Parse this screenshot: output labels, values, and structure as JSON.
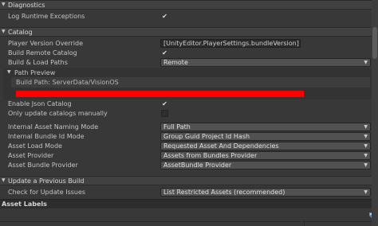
{
  "sections": {
    "diagnostics": "Diagnostics",
    "catalog": "Catalog",
    "update_prev": "Update a Previous Build",
    "asset_labels": "Asset Labels"
  },
  "rows": {
    "log_runtime": "Log Runtime Exceptions",
    "player_version": "Player Version Override",
    "player_version_value": "[UnityEditor.PlayerSettings.bundleVersion]",
    "build_remote": "Build Remote Catalog",
    "build_load_paths": "Build & Load Paths",
    "build_load_paths_value": "Remote",
    "path_preview": "Path Preview",
    "build_path": "Build Path: ServerData/VisionOS",
    "enable_json": "Enable Json Catalog",
    "only_update": "Only update catalogs manually",
    "internal_naming": "Internal Asset Naming Mode",
    "internal_naming_value": "Full Path",
    "bundle_id": "Internal Bundle Id Mode",
    "bundle_id_value": "Group Guid Project Id Hash",
    "asset_load": "Asset Load Mode",
    "asset_load_value": "Requested Asset And Dependencies",
    "asset_provider": "Asset Provider",
    "asset_provider_value": "Assets from Bundles Provider",
    "bundle_provider": "Asset Bundle Provider",
    "bundle_provider_value": "AssetBundle Provider",
    "check_updates": "Check for Update Issues",
    "check_updates_value": "List Restricted Assets (recommended)"
  },
  "glyphs": {
    "check": "✔",
    "caret": "▼",
    "fold_open": "▼"
  },
  "colors": {
    "redaction": "#ff0000",
    "accent_icon": "#4a90e2"
  }
}
